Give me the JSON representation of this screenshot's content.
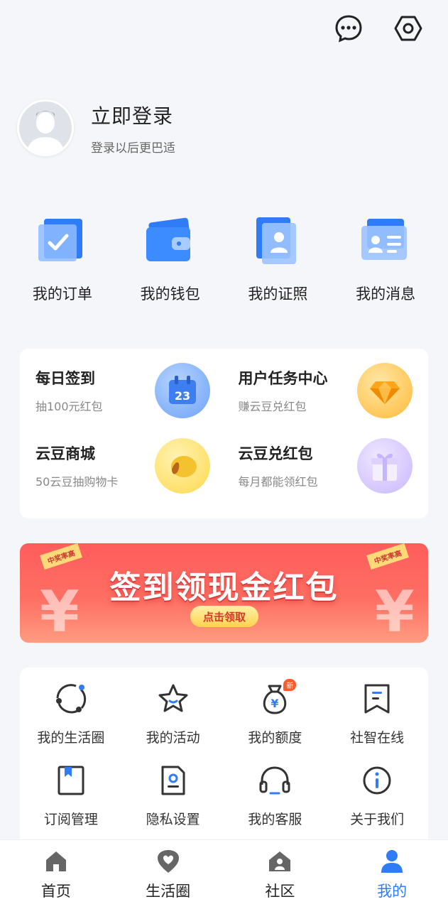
{
  "header": {
    "icons": [
      "chat-bubble-icon",
      "settings-hexagon-icon"
    ]
  },
  "profile": {
    "title": "立即登录",
    "subtitle": "登录以后更巴适"
  },
  "quick_actions": [
    {
      "label": "我的订单",
      "icon": "order-check-icon"
    },
    {
      "label": "我的钱包",
      "icon": "wallet-icon"
    },
    {
      "label": "我的证照",
      "icon": "license-icon"
    },
    {
      "label": "我的消息",
      "icon": "id-card-icon"
    }
  ],
  "tasks": [
    {
      "title": "每日签到",
      "subtitle": "抽100元红包",
      "icon": "calendar-icon",
      "badge_text": "23"
    },
    {
      "title": "用户任务中心",
      "subtitle": "赚云豆兑红包",
      "icon": "diamond-icon"
    },
    {
      "title": "云豆商城",
      "subtitle": "50云豆抽购物卡",
      "icon": "bean-icon"
    },
    {
      "title": "云豆兑红包",
      "subtitle": "每月都能领红包",
      "icon": "gift-box-icon"
    }
  ],
  "banner": {
    "title": "签到领现金红包",
    "button": "点击领取",
    "corner_tag": "中奖率高",
    "yen": "¥"
  },
  "services": [
    {
      "label": "我的生活圈",
      "icon": "orbit-icon"
    },
    {
      "label": "我的活动",
      "icon": "star-icon"
    },
    {
      "label": "我的额度",
      "icon": "money-bag-icon",
      "badge": "新"
    },
    {
      "label": "社智在线",
      "icon": "bookmark-icon"
    },
    {
      "label": "订阅管理",
      "icon": "book-icon"
    },
    {
      "label": "隐私设置",
      "icon": "privacy-file-icon"
    },
    {
      "label": "我的客服",
      "icon": "headset-icon"
    },
    {
      "label": "关于我们",
      "icon": "info-icon"
    }
  ],
  "tabbar": [
    {
      "label": "首页",
      "icon": "home-icon"
    },
    {
      "label": "生活圈",
      "icon": "heart-pin-icon"
    },
    {
      "label": "社区",
      "icon": "community-icon"
    },
    {
      "label": "我的",
      "icon": "user-icon",
      "active": true
    }
  ],
  "colors": {
    "accent": "#2f7cf6",
    "background": "#f5f6fa",
    "banner_red": "#ff5d5d"
  }
}
